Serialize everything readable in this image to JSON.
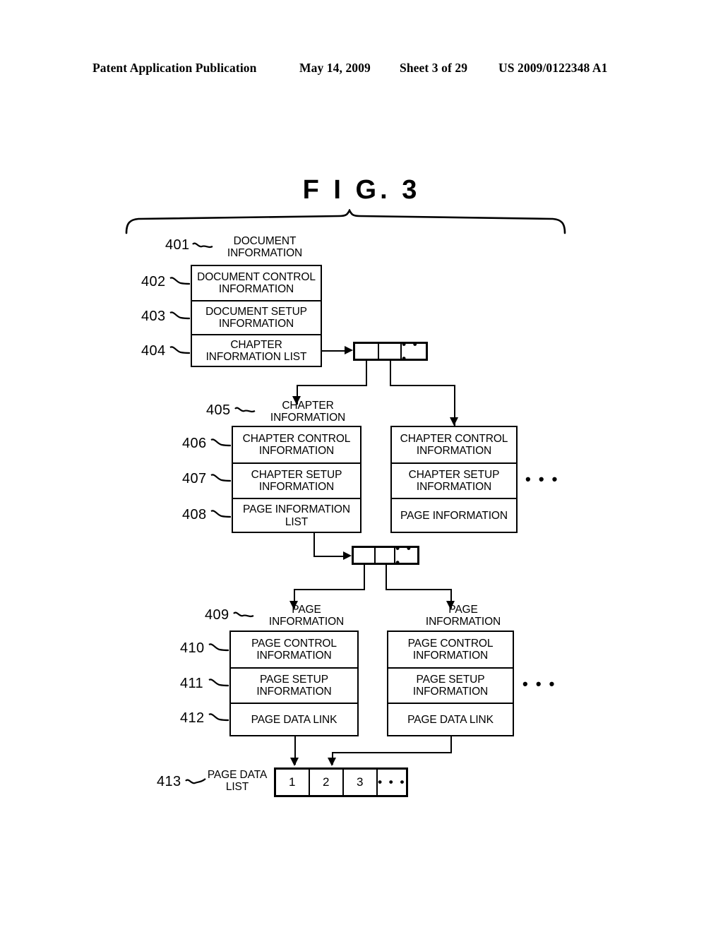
{
  "header": {
    "publication": "Patent Application Publication",
    "date": "May 14, 2009",
    "sheet": "Sheet 3 of 29",
    "patent_number": "US 2009/0122348 A1"
  },
  "figure": {
    "title": "F I G.  3"
  },
  "document_level": {
    "ref": "401",
    "caption": "DOCUMENT\nINFORMATION",
    "rows": [
      {
        "ref": "402",
        "label": "DOCUMENT CONTROL\nINFORMATION"
      },
      {
        "ref": "403",
        "label": "DOCUMENT SETUP\nINFORMATION"
      },
      {
        "ref": "404",
        "label": "CHAPTER\nINFORMATION LIST"
      }
    ]
  },
  "chapter_list_node": {
    "cells": [
      "",
      "",
      "• • •"
    ]
  },
  "chapter_level": {
    "ref": "405",
    "caption": "CHAPTER\nINFORMATION",
    "rows": [
      {
        "ref": "406",
        "label": "CHAPTER CONTROL\nINFORMATION"
      },
      {
        "ref": "407",
        "label": "CHAPTER SETUP\nINFORMATION"
      },
      {
        "ref": "408",
        "label": "PAGE\nINFORMATION LIST"
      }
    ],
    "sibling": {
      "caption": "",
      "rows": [
        {
          "label": "CHAPTER CONTROL\nINFORMATION"
        },
        {
          "label": "CHAPTER SETUP\nINFORMATION"
        },
        {
          "label": "PAGE\nINFORMATION"
        }
      ]
    },
    "more": "• • •"
  },
  "page_list_node": {
    "cells": [
      "",
      "",
      "• • •"
    ]
  },
  "page_level": {
    "ref": "409",
    "caption": "PAGE\nINFORMATION",
    "sibling_caption": "PAGE\nINFORMATION",
    "rows": [
      {
        "ref": "410",
        "label": "PAGE CONTROL\nINFORMATION"
      },
      {
        "ref": "411",
        "label": "PAGE SETUP\nINFORMATION"
      },
      {
        "ref": "412",
        "label": "PAGE DATA LINK"
      }
    ],
    "sibling": {
      "rows": [
        {
          "label": "PAGE CONTROL\nINFORMATION"
        },
        {
          "label": "PAGE SETUP\nINFORMATION"
        },
        {
          "label": "PAGE DATA LINK"
        }
      ]
    },
    "more": "• • •"
  },
  "page_data_list": {
    "ref": "413",
    "caption": "PAGE DATA\nLIST",
    "cells": [
      "1",
      "2",
      "3",
      "• • •"
    ]
  },
  "colors": {
    "ink": "#000000",
    "paper": "#ffffff"
  }
}
